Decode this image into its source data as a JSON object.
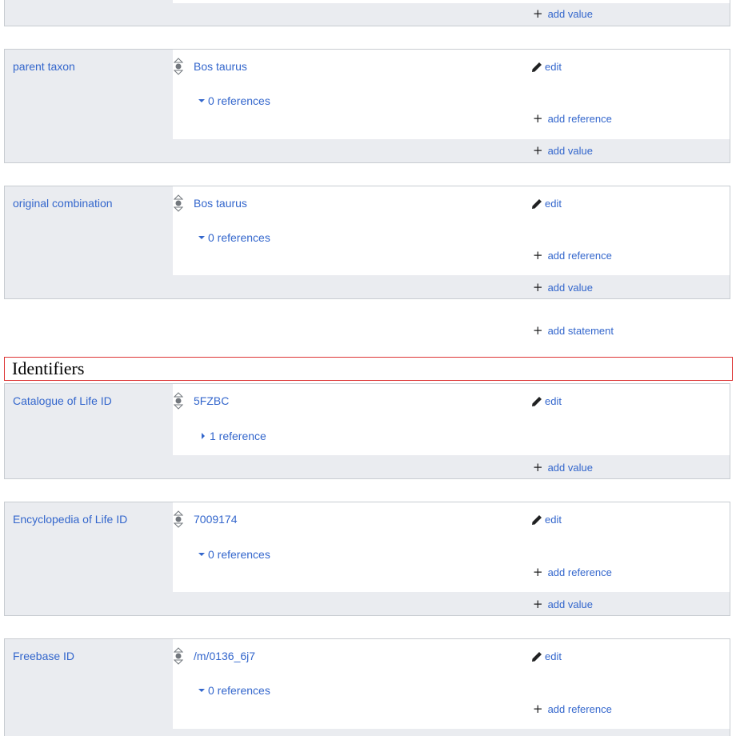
{
  "top_partial": {
    "add_value_label": "add value"
  },
  "statements": [
    {
      "property": "parent taxon",
      "value": "Bos taurus",
      "edit_label": "edit",
      "references_label": "0 references",
      "references_expanded": true,
      "add_reference_label": "add reference",
      "add_value_label": "add value"
    },
    {
      "property": "original combination",
      "value": "Bos taurus",
      "edit_label": "edit",
      "references_label": "0 references",
      "references_expanded": true,
      "add_reference_label": "add reference",
      "add_value_label": "add value"
    }
  ],
  "add_statement_label": "add statement",
  "identifiers_heading": "Identifiers",
  "identifiers": [
    {
      "property": "Catalogue of Life ID",
      "value": "5FZBC",
      "edit_label": "edit",
      "references_label": "1 reference",
      "references_expanded": false,
      "add_value_label": "add value"
    },
    {
      "property": "Encyclopedia of Life ID",
      "value": "7009174",
      "edit_label": "edit",
      "references_label": "0 references",
      "references_expanded": true,
      "add_reference_label": "add reference",
      "add_value_label": "add value"
    },
    {
      "property": "Freebase ID",
      "value": "/m/0136_6j7",
      "edit_label": "edit",
      "references_label": "0 references",
      "references_expanded": true,
      "add_reference_label": "add reference"
    }
  ],
  "colors": {
    "link": "#3366cc",
    "group_bg": "#eaecf0",
    "border": "#c8ccd1",
    "heading_border": "#dd3333"
  }
}
